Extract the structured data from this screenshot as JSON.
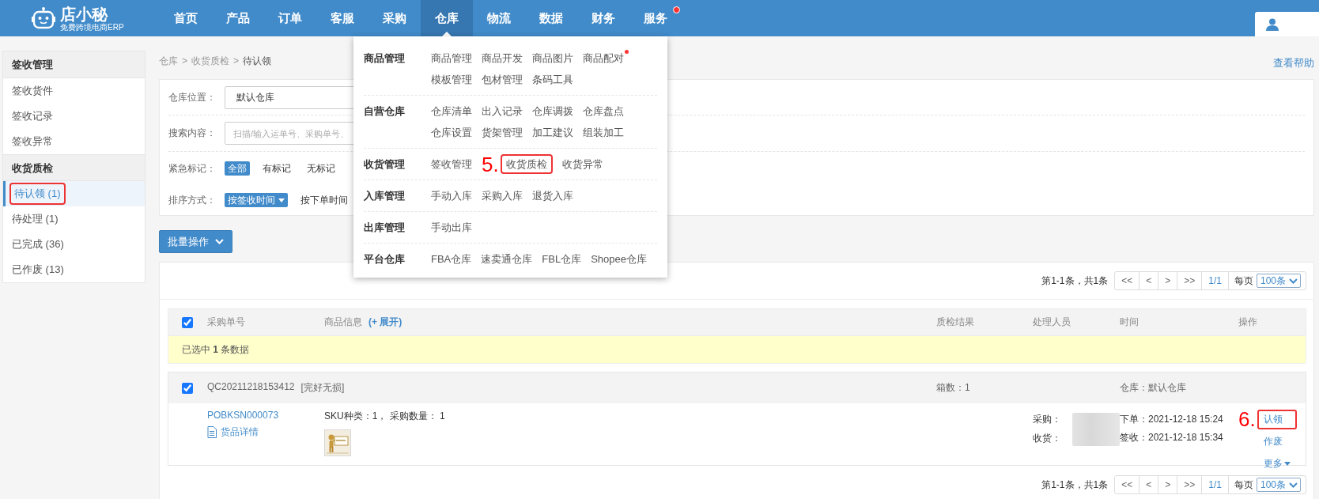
{
  "header": {
    "logo": {
      "name": "店小秘",
      "tagline": "免费跨境电商ERP"
    },
    "nav": [
      {
        "label": "首页",
        "selected": false,
        "badge_dot": false
      },
      {
        "label": "产品",
        "selected": false,
        "badge_dot": false
      },
      {
        "label": "订单",
        "selected": false,
        "badge_dot": false
      },
      {
        "label": "客服",
        "selected": false,
        "badge_dot": false
      },
      {
        "label": "采购",
        "selected": false,
        "badge_dot": false
      },
      {
        "label": "仓库",
        "selected": true,
        "badge_dot": false
      },
      {
        "label": "物流",
        "selected": false,
        "badge_dot": false
      },
      {
        "label": "数据",
        "selected": false,
        "badge_dot": false
      },
      {
        "label": "财务",
        "selected": false,
        "badge_dot": false
      },
      {
        "label": "服务",
        "selected": false,
        "badge_dot": true
      }
    ]
  },
  "sidebar": {
    "groups": [
      {
        "title": "签收管理",
        "items": [
          {
            "label": "签收货件",
            "selected": false,
            "highlighted": false
          },
          {
            "label": "签收记录",
            "selected": false,
            "highlighted": false
          },
          {
            "label": "签收异常",
            "selected": false,
            "highlighted": false
          }
        ]
      },
      {
        "title": "收货质检",
        "items": [
          {
            "label": "待认领 (1)",
            "selected": true,
            "highlighted": true
          },
          {
            "label": "待处理 (1)",
            "selected": false,
            "highlighted": false
          },
          {
            "label": "已完成 (36)",
            "selected": false,
            "highlighted": false
          },
          {
            "label": "已作废 (13)",
            "selected": false,
            "highlighted": false
          }
        ]
      }
    ]
  },
  "breadcrumb": {
    "items": [
      "仓库",
      "收货质检",
      "待认领"
    ],
    "separator": ">"
  },
  "help_link": "查看帮助",
  "filters": [
    {
      "kind": "select",
      "label": "仓库位置：",
      "value": "默认仓库"
    },
    {
      "kind": "input",
      "label": "搜索内容：",
      "placeholder": "扫描/输入运单号、采购单号、"
    },
    {
      "kind": "chips",
      "label": "紧急标记：",
      "options": [
        {
          "label": "全部",
          "selected": true,
          "dropdown": false
        },
        {
          "label": "有标记",
          "selected": false,
          "dropdown": false
        },
        {
          "label": "无标记",
          "selected": false,
          "dropdown": false
        }
      ]
    },
    {
      "kind": "chips",
      "label": "排序方式：",
      "options": [
        {
          "label": "按签收时间",
          "selected": true,
          "dropdown": true
        },
        {
          "label": "按下单时间",
          "selected": false,
          "dropdown": false
        }
      ]
    }
  ],
  "batch_button": "批量操作",
  "pager_top": {
    "summary": "第1-1条，共1条",
    "buttons": [
      "<<",
      "<",
      ">",
      ">>"
    ],
    "page": "1/1",
    "per_page_label": "每页",
    "per_page": "100条"
  },
  "table": {
    "select_all_checked": true,
    "columns": [
      {
        "label": "采购单号"
      },
      {
        "label": "商品信息",
        "expand_link": "(+ 展开)"
      },
      {
        "label": "质检结果"
      },
      {
        "label": "处理人员"
      },
      {
        "label": "时间"
      },
      {
        "label": "操作"
      }
    ],
    "selection_notice": "已选中 **1** 条数据",
    "groups": [
      {
        "checked": true,
        "code": "QC20211218153412",
        "status": "[完好无损]",
        "boxes": "箱数：1",
        "warehouse": "仓库：默认仓库",
        "rows": [
          {
            "po": "POBKSN000073",
            "detail_link": "货品详情",
            "sku": "SKU种类：1， 采购数量： 1",
            "image": {
              "kind": "picture"
            },
            "handlers": [
              "采购：",
              "收货："
            ],
            "times": [
              "下单：2021-12-18 15:24",
              "签收：2021-12-18 15:34"
            ],
            "actions": [
              {
                "label": "认领",
                "highlighted": true,
                "dropdown": false,
                "annotation": "6."
              },
              {
                "label": "作废",
                "highlighted": false,
                "dropdown": false
              },
              {
                "label": "更多",
                "highlighted": false,
                "dropdown": true
              }
            ]
          }
        ]
      }
    ]
  },
  "pager_bottom": {
    "summary": "第1-1条，共1条",
    "buttons": [
      "<<",
      "<",
      ">",
      ">>"
    ],
    "page": "1/1",
    "per_page_label": "每页",
    "per_page": "100条"
  },
  "menu": {
    "sections": [
      {
        "title": "商品管理",
        "items": [
          {
            "label": "商品管理",
            "highlighted": false,
            "badge_dot": false
          },
          {
            "label": "商品开发",
            "highlighted": false,
            "badge_dot": false
          },
          {
            "label": "商品图片",
            "highlighted": false,
            "badge_dot": false
          },
          {
            "label": "商品配对",
            "highlighted": false,
            "badge_dot": true
          },
          {
            "label": "模板管理",
            "highlighted": false,
            "badge_dot": false
          },
          {
            "label": "包材管理",
            "highlighted": false,
            "badge_dot": false
          },
          {
            "label": "条码工具",
            "highlighted": false,
            "badge_dot": false
          }
        ]
      },
      {
        "title": "自营仓库",
        "items": [
          {
            "label": "仓库清单",
            "highlighted": false,
            "badge_dot": false
          },
          {
            "label": "出入记录",
            "highlighted": false,
            "badge_dot": false
          },
          {
            "label": "仓库调拨",
            "highlighted": false,
            "badge_dot": false
          },
          {
            "label": "仓库盘点",
            "highlighted": false,
            "badge_dot": false
          },
          {
            "label": "仓库设置",
            "highlighted": false,
            "badge_dot": false
          },
          {
            "label": "货架管理",
            "highlighted": false,
            "badge_dot": false
          },
          {
            "label": "加工建议",
            "highlighted": false,
            "badge_dot": false
          },
          {
            "label": "组装加工",
            "highlighted": false,
            "badge_dot": false
          }
        ]
      },
      {
        "title": "收货管理",
        "items": [
          {
            "label": "签收管理",
            "highlighted": false,
            "badge_dot": false
          },
          {
            "label": "收货质检",
            "highlighted": true,
            "badge_dot": false,
            "annotation": "5."
          },
          {
            "label": "收货异常",
            "highlighted": false,
            "badge_dot": false
          }
        ]
      },
      {
        "title": "入库管理",
        "items": [
          {
            "label": "手动入库",
            "highlighted": false,
            "badge_dot": false
          },
          {
            "label": "采购入库",
            "highlighted": false,
            "badge_dot": false
          },
          {
            "label": "退货入库",
            "highlighted": false,
            "badge_dot": false
          }
        ]
      },
      {
        "title": "出库管理",
        "items": [
          {
            "label": "手动出库",
            "highlighted": false,
            "badge_dot": false
          }
        ]
      },
      {
        "title": "平台仓库",
        "items": [
          {
            "label": "FBA仓库",
            "highlighted": false,
            "badge_dot": false
          },
          {
            "label": "速卖通仓库",
            "highlighted": false,
            "badge_dot": false
          },
          {
            "label": "FBL仓库",
            "highlighted": false,
            "badge_dot": false
          },
          {
            "label": "Shopee仓库",
            "highlighted": false,
            "badge_dot": false
          }
        ]
      }
    ]
  }
}
